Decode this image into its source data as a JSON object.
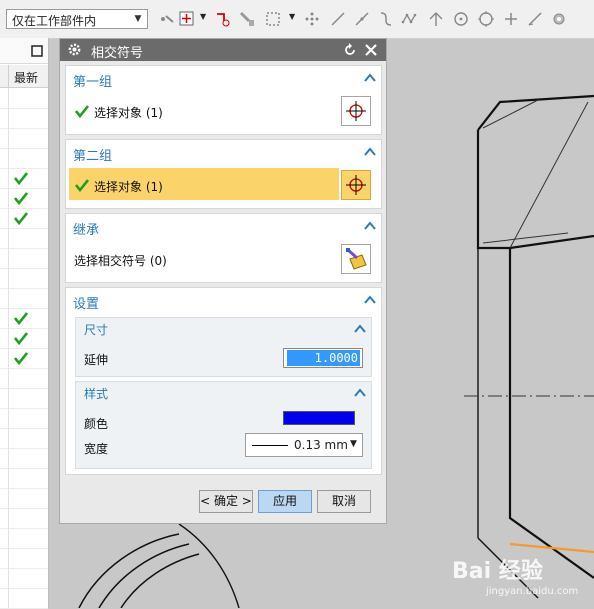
{
  "toolbar": {
    "filter_value": "仅在工作部件内",
    "icons": [
      "point-snap-icon",
      "point-constructor-icon",
      "point-dropdown-icon",
      "point-insert-icon",
      "paintbrush-icon",
      "rectangle-select-icon",
      "scatter-points-icon",
      "line-icon",
      "line-2-icon",
      "curve-icon",
      "spline-icon",
      "vertical-line-icon",
      "circle-center-icon",
      "circle-icon",
      "plus-icon",
      "diagonal-line-icon",
      "settings-icon"
    ]
  },
  "left_panel": {
    "column_header": "最新",
    "checked_rows": [
      4,
      5,
      6,
      11,
      12,
      13
    ]
  },
  "dialog": {
    "title": "相交符号",
    "group1": {
      "title": "第一组",
      "select_label": "选择对象 (1)"
    },
    "group2": {
      "title": "第二组",
      "select_label": "选择对象 (1)"
    },
    "inherit": {
      "title": "继承",
      "select_label": "选择相交符号 (0)"
    },
    "settings": {
      "title": "设置",
      "size": {
        "title": "尺寸",
        "extend_label": "延伸",
        "extend_value": "1.0000"
      },
      "style": {
        "title": "样式",
        "color_label": "颜色",
        "color": "#0000ee",
        "width_label": "宽度",
        "width_value": "0.13 mm"
      }
    },
    "buttons": {
      "ok": "< 确定 >",
      "apply": "应用",
      "cancel": "取消"
    }
  },
  "watermark": {
    "brand": "Bai 经验",
    "url": "jingyan.baidu.com"
  }
}
